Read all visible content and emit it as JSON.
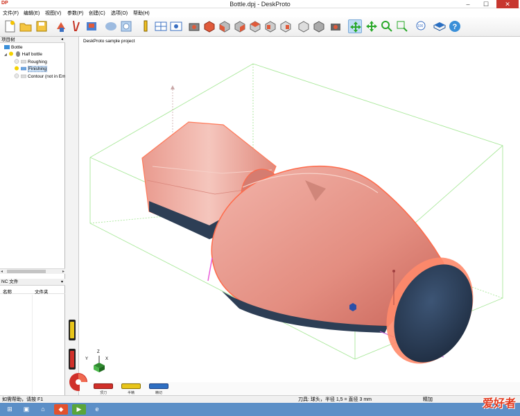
{
  "window": {
    "app_logo": "DP",
    "title": "Bottle.dpj - DeskProto",
    "minimize": "–",
    "maximize": "☐",
    "close": "✕"
  },
  "menu": [
    "文件(F)",
    "编辑(E)",
    "视图(V)",
    "参数(P)",
    "创建(C)",
    "选项(O)",
    "帮助(H)"
  ],
  "project_tree": {
    "header": "项目树",
    "items": [
      {
        "label": "Bottle",
        "icon": "project-icon",
        "level": 0
      },
      {
        "label": "Half bottle",
        "icon": "part-icon",
        "level": 1
      },
      {
        "label": "Roughing",
        "icon": "operation-icon",
        "level": 2
      },
      {
        "label": "Finishing",
        "icon": "operation-icon",
        "level": 2,
        "selected": true
      },
      {
        "label": "Contour (not in Em",
        "icon": "operation-icon",
        "level": 2
      }
    ]
  },
  "nc_panel": {
    "header": "NC 文件",
    "columns": [
      "名称",
      "文件夹"
    ]
  },
  "viewport": {
    "label": "DeskProto sample project",
    "axes": {
      "x": "X",
      "y": "Y",
      "z": "Z"
    }
  },
  "bottom_buttons": [
    {
      "label": "顶刀",
      "color": "#d0302a"
    },
    {
      "label": "半精",
      "color": "#e8c51a"
    },
    {
      "label": "精切",
      "color": "#2f6fc2"
    }
  ],
  "status": {
    "help": "如需帮助，请按 F1",
    "tool": "刀具: 球头，半径 1,5 = 直径 3 mm",
    "right": "精加"
  },
  "watermark": "爱好者",
  "colors": {
    "model": "#e8968a",
    "model_edge": "#ff6a4a",
    "box": "#9be08a",
    "dark": "#2d3e55"
  }
}
